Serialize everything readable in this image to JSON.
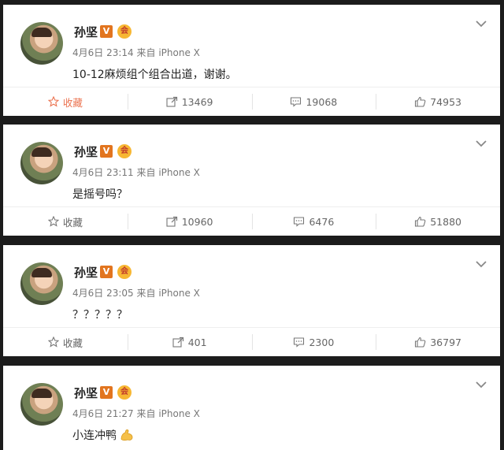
{
  "posts": [
    {
      "username": "孙坚",
      "v_badge": "V",
      "member_badge": "会",
      "time": "4月6日 23:14",
      "source": "来自 iPhone X",
      "content": "10-12麻烦组个组合出道，谢谢。",
      "actions": {
        "favorite": "收藏",
        "repost": "13469",
        "comment": "19068",
        "like": "74953"
      },
      "favorite_color": "#eb7350"
    },
    {
      "username": "孙坚",
      "v_badge": "V",
      "member_badge": "会",
      "time": "4月6日 23:11",
      "source": "来自 iPhone X",
      "content": "是摇号吗？",
      "actions": {
        "favorite": "收藏",
        "repost": "10960",
        "comment": "6476",
        "like": "51880"
      }
    },
    {
      "username": "孙坚",
      "v_badge": "V",
      "member_badge": "会",
      "time": "4月6日 23:05",
      "source": "来自 iPhone X",
      "content": "？？？？？",
      "actions": {
        "favorite": "收藏",
        "repost": "401",
        "comment": "2300",
        "like": "36797"
      }
    },
    {
      "username": "孙坚",
      "v_badge": "V",
      "member_badge": "会",
      "time": "4月6日 21:27",
      "source": "来自 iPhone X",
      "content": "小连冲鸭",
      "content_emoji": "muscle-emoji"
    }
  ]
}
